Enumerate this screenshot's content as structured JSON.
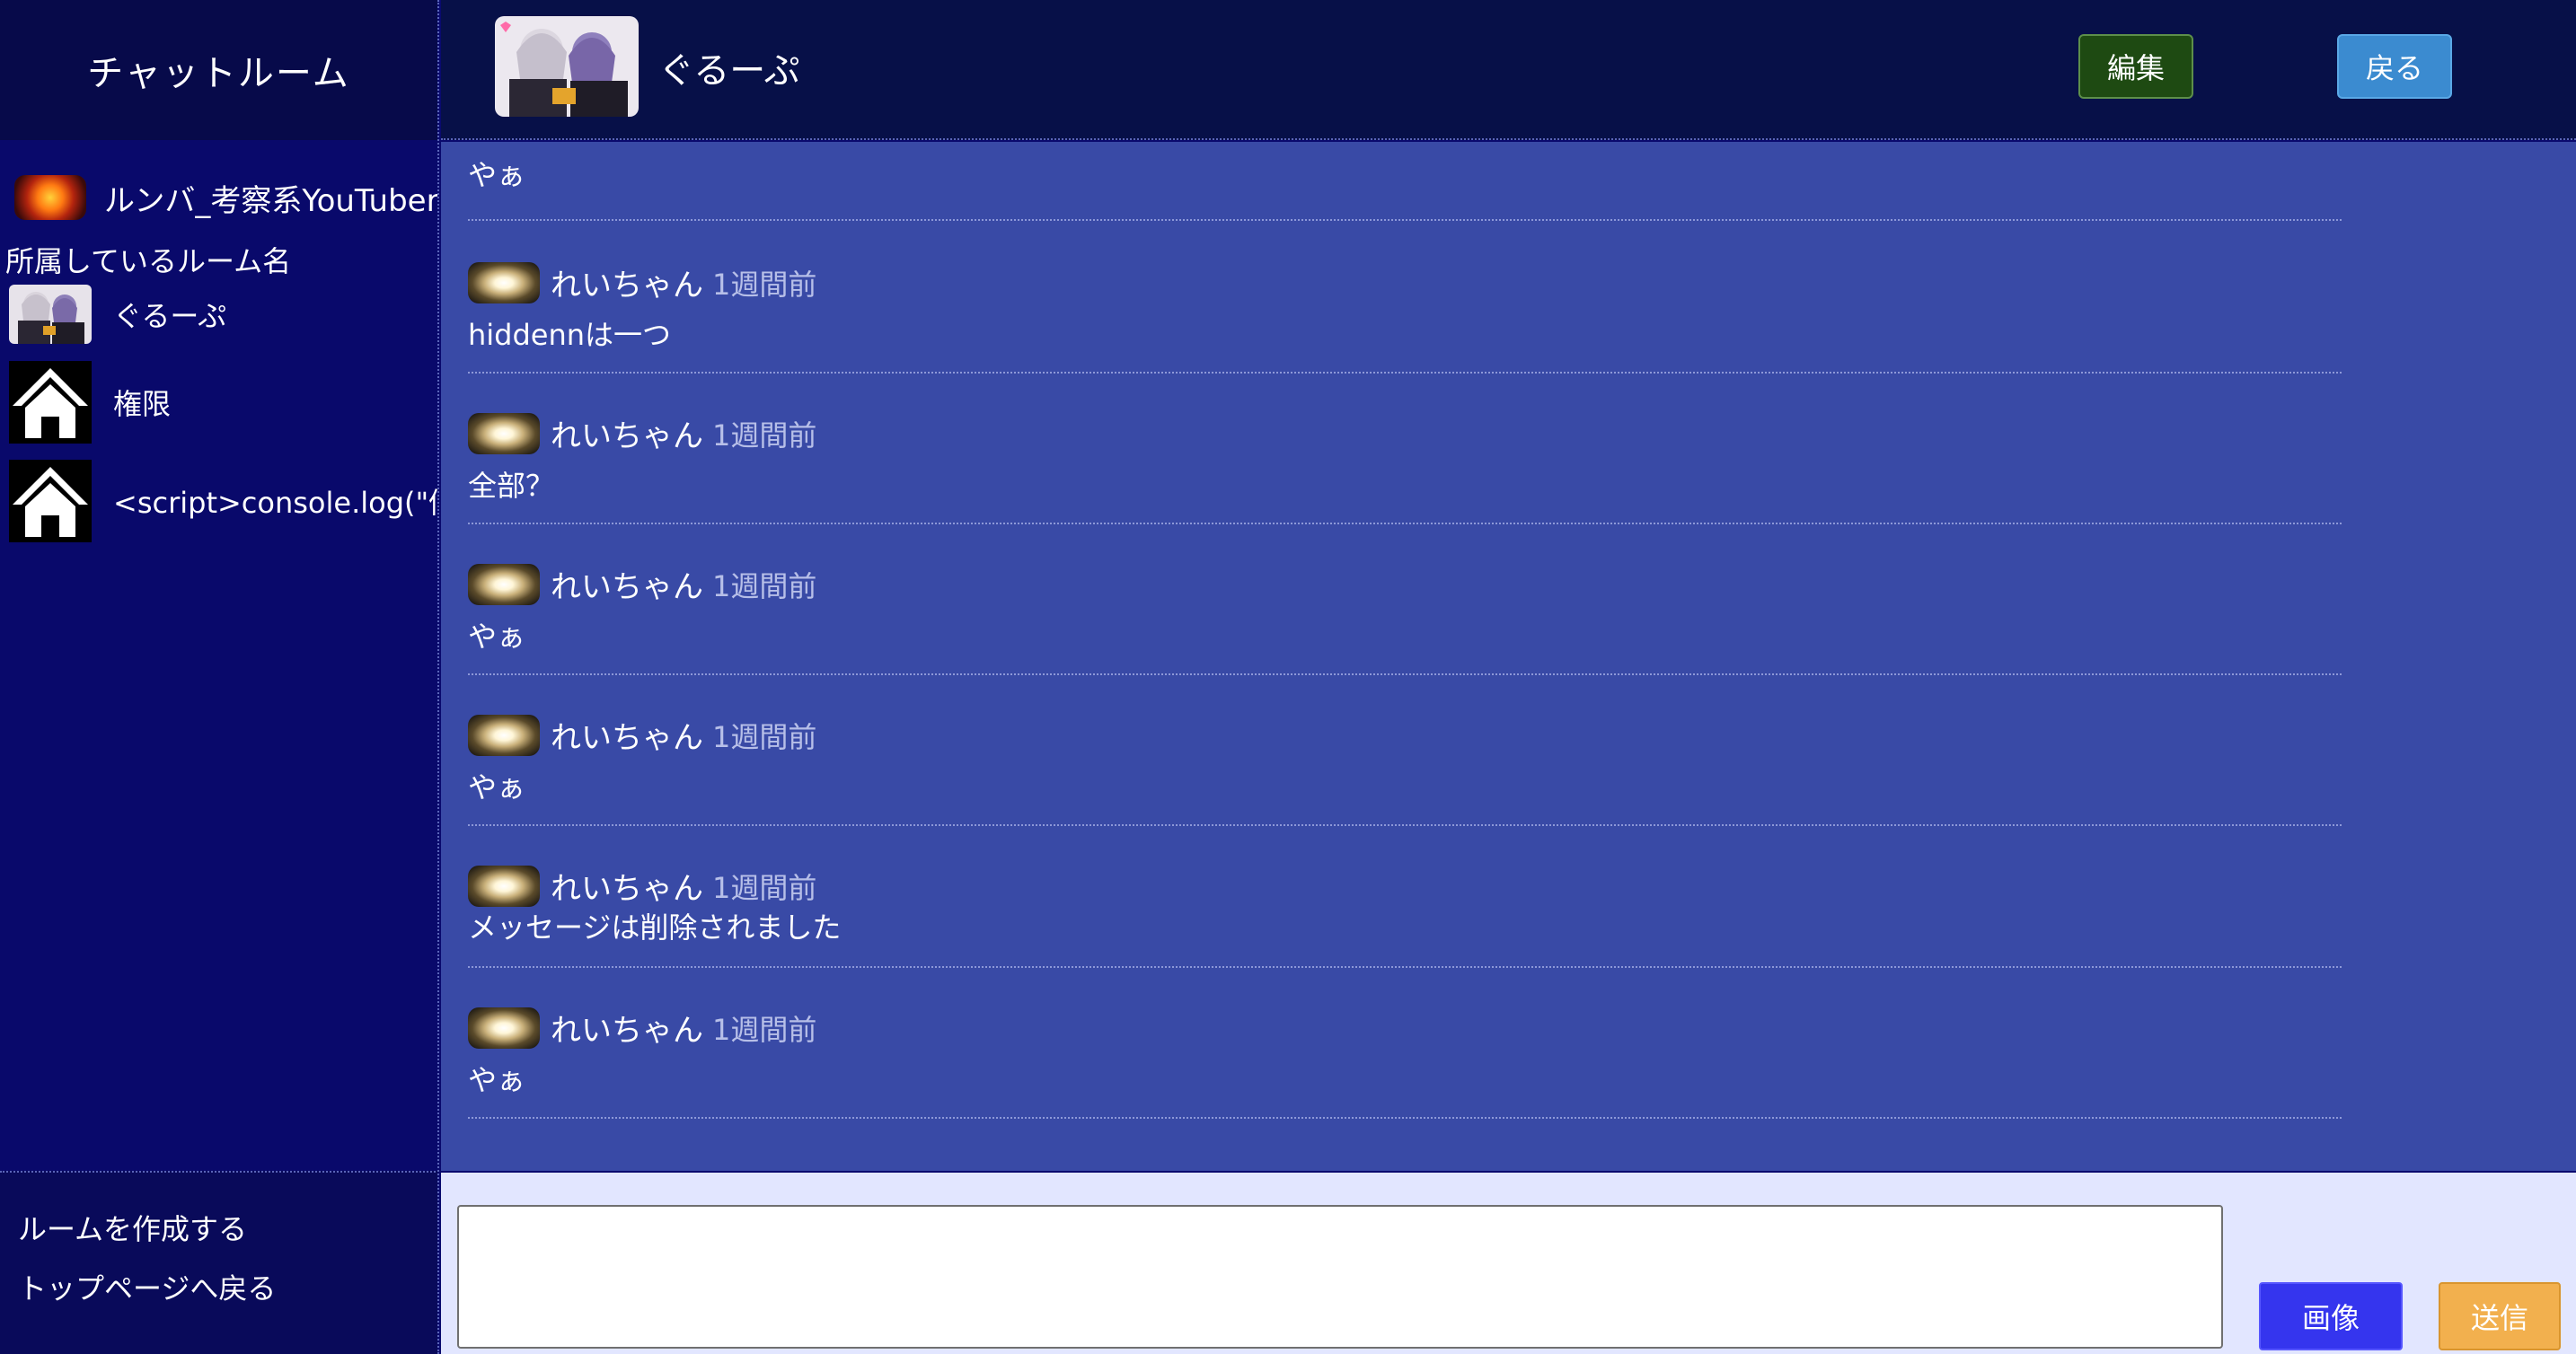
{
  "sidebar": {
    "title": "チャットルーム",
    "me": {
      "name": "ルンバ_考察系YouTuber",
      "avatar_icon": "fire-avatar-icon"
    },
    "rooms_heading": "所属しているルーム名",
    "rooms": [
      {
        "label": "ぐるーぷ",
        "icon": "group-avatar-icon"
      },
      {
        "label": "権限",
        "icon": "house-icon"
      },
      {
        "label": "<script>console.log(\"修正",
        "icon": "house-icon"
      }
    ],
    "footer": {
      "create_room": "ルームを作成する",
      "back_to_top": "トップページへ戻る"
    }
  },
  "header": {
    "room_name": "ぐるーぷ",
    "edit_label": "編集",
    "back_label": "戻る"
  },
  "messages": [
    {
      "user": "",
      "time": "",
      "text": "やぁ",
      "partial": true
    },
    {
      "user": "れいちゃん",
      "time": "1週間前",
      "text": "hiddennは一つ"
    },
    {
      "user": "れいちゃん",
      "time": "1週間前",
      "text": "全部？"
    },
    {
      "user": "れいちゃん",
      "time": "1週間前",
      "text": "やぁ"
    },
    {
      "user": "れいちゃん",
      "time": "1週間前",
      "text": "やぁ"
    },
    {
      "user": "れいちゃん",
      "time": "1週間前",
      "text": "メッセージは削除されました"
    },
    {
      "user": "れいちゃん",
      "time": "1週間前",
      "text": "やぁ"
    }
  ],
  "composer": {
    "input_value": "",
    "image_label": "画像",
    "send_label": "送信"
  },
  "colors": {
    "sidebar_bg": "#09096b",
    "header_bg": "#071048",
    "messages_bg": "#394aa6",
    "composer_bg": "#e2e6ff",
    "edit_button": "#1e4a12",
    "back_button": "#3b8bd0",
    "image_button": "#3535ee",
    "send_button": "#f2b04e"
  }
}
